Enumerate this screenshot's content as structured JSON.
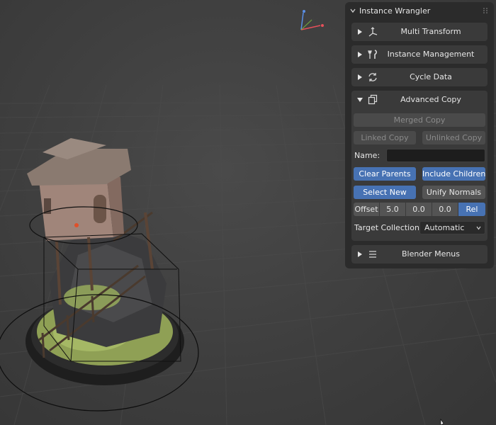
{
  "panel": {
    "title": "Instance Wrangler",
    "sections": {
      "multi_transform": "Multi Transform",
      "instance_management": "Instance Management",
      "cycle_data": "Cycle Data",
      "advanced_copy": "Advanced Copy",
      "blender_menus": "Blender Menus"
    },
    "advanced_copy": {
      "merged_copy": "Merged Copy",
      "linked_copy": "Linked Copy",
      "unlinked_copy": "Unlinked Copy",
      "name_label": "Name:",
      "name_value": "",
      "clear_parents": "Clear Parents",
      "include_children": "Include Children",
      "select_new": "Select New",
      "unify_normals": "Unify Normals",
      "offset_label": "Offset",
      "offset_x": "5.0",
      "offset_y": "0.0",
      "offset_z": "0.0",
      "rel_label": "Rel",
      "target_collection_label": "Target Collection:",
      "target_collection_value": "Automatic"
    }
  },
  "colors": {
    "accent_blue": "#4772b3",
    "panel_bg": "#2b2b2b",
    "subpanel_bg": "#3a3a3a",
    "viewport_bg": "#404040"
  },
  "icons": {
    "multi_transform": "transform-axes-icon",
    "instance_management": "tools-icon",
    "cycle_data": "cycle-arrows-icon",
    "advanced_copy": "duplicate-icon",
    "blender_menus": "menu-lines-icon"
  }
}
